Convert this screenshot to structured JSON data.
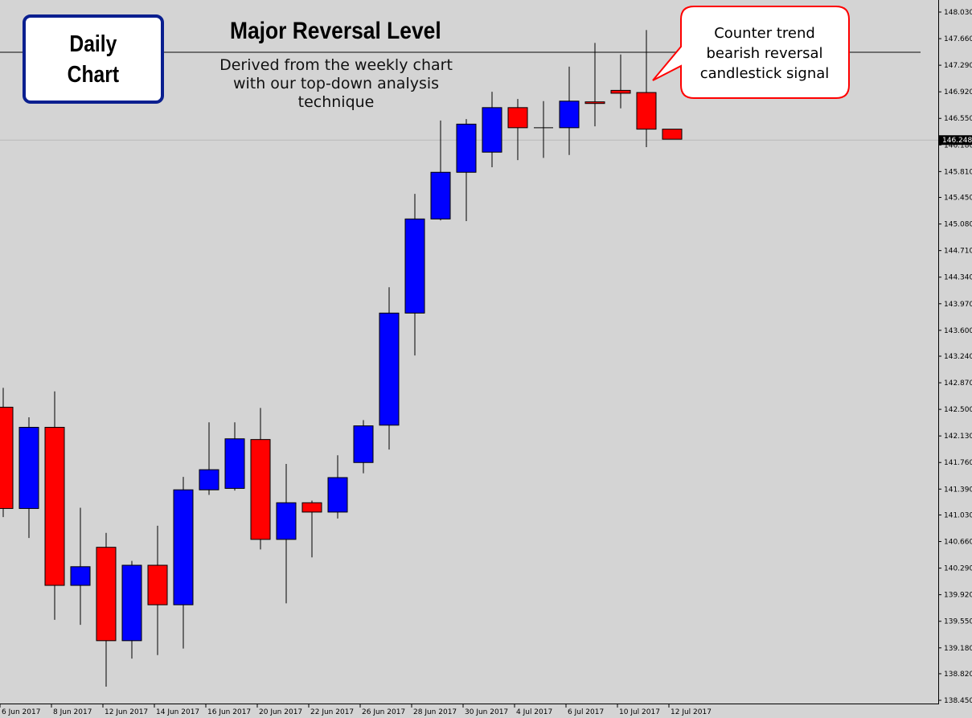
{
  "chart_data": {
    "type": "candlestick",
    "title": "Major Reversal Level",
    "subtitle": "Derived from the weekly chart with our top-down analysis technique",
    "timeframe_label": "Daily Chart",
    "annotation": "Counter trend bearish reversal candlestick signal",
    "ylim": [
      138.45,
      148.03
    ],
    "y_ticks": [
      "148.030",
      "147.660",
      "147.290",
      "146.920",
      "146.550",
      "146.180",
      "145.810",
      "145.450",
      "145.080",
      "144.710",
      "144.340",
      "143.970",
      "143.600",
      "143.240",
      "142.870",
      "142.500",
      "142.130",
      "141.760",
      "141.390",
      "141.030",
      "140.660",
      "140.290",
      "139.920",
      "139.550",
      "139.180",
      "138.820",
      "138.450"
    ],
    "current_price": "146.248",
    "reversal_level": 147.48,
    "x_ticks": [
      "6 Jun 2017",
      "8 Jun 2017",
      "12 Jun 2017",
      "14 Jun 2017",
      "16 Jun 2017",
      "20 Jun 2017",
      "22 Jun 2017",
      "26 Jun 2017",
      "28 Jun 2017",
      "30 Jun 2017",
      "4 Jul 2017",
      "6 Jul 2017",
      "10 Jul 2017",
      "12 Jul 2017"
    ],
    "colors": {
      "bull": "#0000ff",
      "bear": "#ff0000",
      "background": "#d4d4d4",
      "callout_border": "#ff0000",
      "label_box_border": "#0a1f8f"
    },
    "candles": [
      {
        "o": 142.53,
        "h": 142.8,
        "l": 141.0,
        "c": 141.12
      },
      {
        "o": 141.12,
        "h": 142.39,
        "l": 140.71,
        "c": 142.25
      },
      {
        "o": 142.25,
        "h": 142.75,
        "l": 139.57,
        "c": 140.05
      },
      {
        "o": 140.05,
        "h": 141.13,
        "l": 139.5,
        "c": 140.31
      },
      {
        "o": 140.58,
        "h": 140.78,
        "l": 138.64,
        "c": 139.28
      },
      {
        "o": 139.28,
        "h": 140.39,
        "l": 139.03,
        "c": 140.33
      },
      {
        "o": 140.33,
        "h": 140.88,
        "l": 139.08,
        "c": 139.78
      },
      {
        "o": 139.78,
        "h": 141.56,
        "l": 139.17,
        "c": 141.38
      },
      {
        "o": 141.38,
        "h": 142.32,
        "l": 141.31,
        "c": 141.66
      },
      {
        "o": 141.4,
        "h": 142.32,
        "l": 141.37,
        "c": 142.09
      },
      {
        "o": 142.08,
        "h": 142.52,
        "l": 140.55,
        "c": 140.69
      },
      {
        "o": 140.69,
        "h": 141.74,
        "l": 139.8,
        "c": 141.2
      },
      {
        "o": 141.2,
        "h": 141.23,
        "l": 140.44,
        "c": 141.07
      },
      {
        "o": 141.07,
        "h": 141.86,
        "l": 140.98,
        "c": 141.55
      },
      {
        "o": 141.76,
        "h": 142.35,
        "l": 141.61,
        "c": 142.27
      },
      {
        "o": 142.28,
        "h": 144.2,
        "l": 141.94,
        "c": 143.84
      },
      {
        "o": 143.84,
        "h": 145.5,
        "l": 143.25,
        "c": 145.15
      },
      {
        "o": 145.15,
        "h": 146.52,
        "l": 145.13,
        "c": 145.8
      },
      {
        "o": 145.8,
        "h": 146.54,
        "l": 145.12,
        "c": 146.47
      },
      {
        "o": 146.08,
        "h": 146.92,
        "l": 145.87,
        "c": 146.7
      },
      {
        "o": 146.7,
        "h": 146.82,
        "l": 145.97,
        "c": 146.42
      },
      {
        "o": 146.42,
        "h": 146.79,
        "l": 146.0,
        "c": 146.42
      },
      {
        "o": 146.42,
        "h": 147.27,
        "l": 146.04,
        "c": 146.79
      },
      {
        "o": 146.78,
        "h": 147.6,
        "l": 146.44,
        "c": 146.76
      },
      {
        "o": 146.94,
        "h": 147.44,
        "l": 146.69,
        "c": 146.9
      },
      {
        "o": 146.91,
        "h": 147.78,
        "l": 146.15,
        "c": 146.4
      },
      {
        "o": 146.4,
        "h": 146.4,
        "l": 146.26,
        "c": 146.26
      }
    ]
  }
}
